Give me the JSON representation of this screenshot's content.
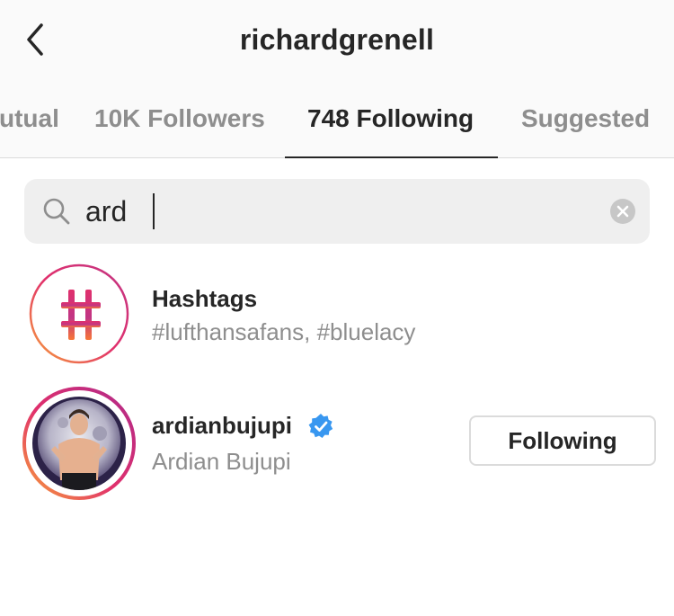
{
  "header": {
    "title": "richardgrenell",
    "back_icon": "chevron-left-icon"
  },
  "tabs": [
    {
      "label": "utual"
    },
    {
      "label": "10K Followers"
    },
    {
      "label": "748 Following",
      "active": true
    },
    {
      "label": "Suggested"
    }
  ],
  "search": {
    "value": "ard",
    "icon": "search-icon",
    "clear_icon": "clear-icon"
  },
  "results": [
    {
      "type": "hashtags",
      "primary": "Hashtags",
      "secondary": "#lufthansafans, #bluelacy",
      "icon": "hashtag-icon"
    },
    {
      "type": "user",
      "primary": "ardianbujupi",
      "secondary": "Ardian Bujupi",
      "verified": true,
      "button_label": "Following"
    }
  ],
  "colors": {
    "verified": "#3897f0",
    "ring_start": "#f7a03a",
    "ring_end": "#c13584"
  }
}
